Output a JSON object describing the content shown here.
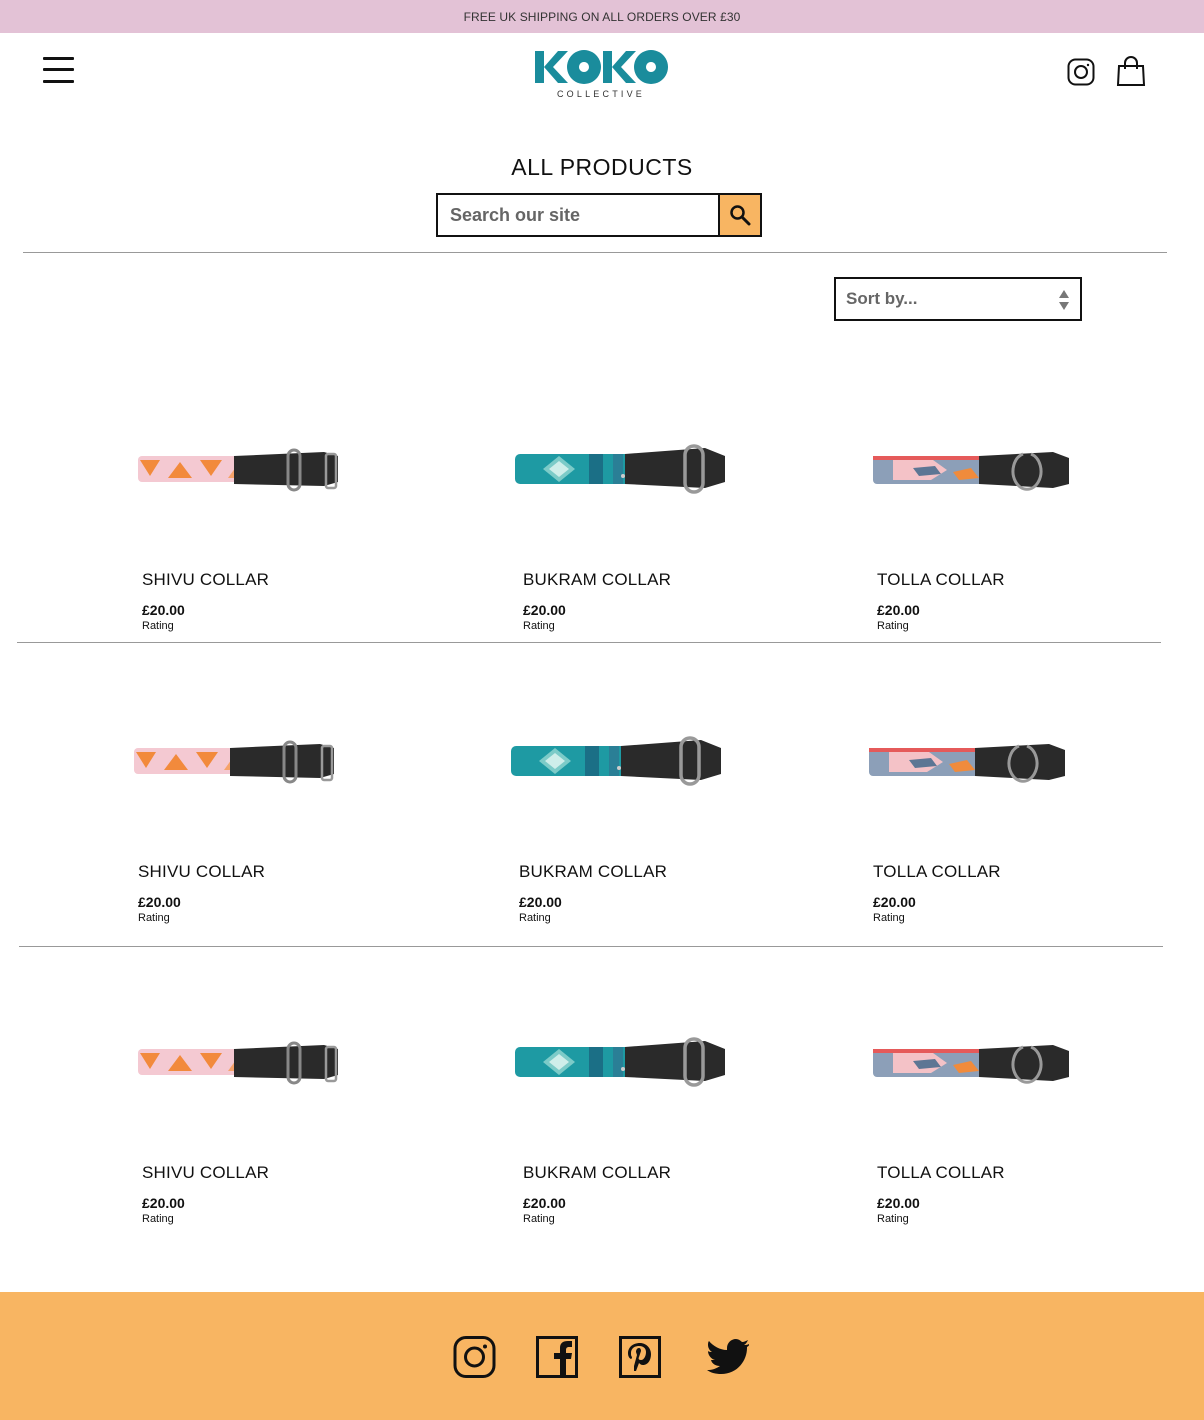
{
  "promo": {
    "text": "FREE UK SHIPPING ON ALL ORDERS OVER £30"
  },
  "header": {
    "logo_main": "KOKO",
    "logo_sub": "COLLECTIVE",
    "menu_icon": "hamburger-menu-icon",
    "instagram_icon": "instagram-icon",
    "bag_icon": "shopping-bag-icon"
  },
  "page": {
    "title": "ALL PRODUCTS"
  },
  "search": {
    "placeholder": "Search our site",
    "icon": "search-icon"
  },
  "sort": {
    "label": "Sort by...",
    "icon": "sort-arrows-icon"
  },
  "rows": [
    {
      "products": [
        {
          "name": "SHIVU COLLAR",
          "price": "£20.00",
          "rating_label": "Rating",
          "variant": "pink"
        },
        {
          "name": "BUKRAM COLLAR",
          "price": "£20.00",
          "rating_label": "Rating",
          "variant": "teal"
        },
        {
          "name": "TOLLA COLLAR",
          "price": "£20.00",
          "rating_label": "Rating",
          "variant": "tolla"
        }
      ]
    },
    {
      "products": [
        {
          "name": "SHIVU COLLAR",
          "price": "£20.00",
          "rating_label": "Rating",
          "variant": "pink"
        },
        {
          "name": "BUKRAM COLLAR",
          "price": "£20.00",
          "rating_label": "Rating",
          "variant": "teal"
        },
        {
          "name": "TOLLA COLLAR",
          "price": "£20.00",
          "rating_label": "Rating",
          "variant": "tolla"
        }
      ]
    },
    {
      "products": [
        {
          "name": "SHIVU COLLAR",
          "price": "£20.00",
          "rating_label": "Rating",
          "variant": "pink"
        },
        {
          "name": "BUKRAM COLLAR",
          "price": "£20.00",
          "rating_label": "Rating",
          "variant": "teal"
        },
        {
          "name": "TOLLA COLLAR",
          "price": "£20.00",
          "rating_label": "Rating",
          "variant": "tolla"
        }
      ]
    }
  ],
  "footer": {
    "social_icons": [
      "instagram-icon",
      "facebook-icon",
      "pinterest-icon",
      "twitter-icon"
    ]
  },
  "colors": {
    "promo_bg": "#e3c2d6",
    "accent_orange": "#f8b562",
    "logo_teal": "#1a8c9c"
  }
}
